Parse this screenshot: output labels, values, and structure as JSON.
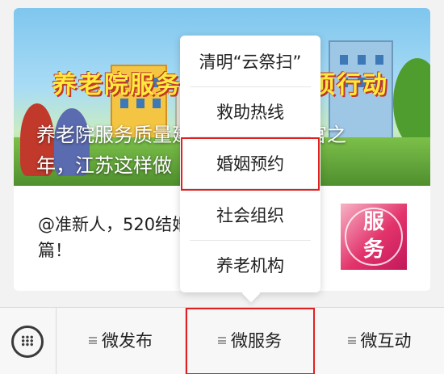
{
  "article": {
    "banner_text": "养老院服务质量建设专项行动",
    "headline_line1": "养老院服务质量建设专项行动收官之",
    "headline_line2": "年，江苏这样做",
    "summary_line1": "@准新人，520结婚登记攻略",
    "summary_line2": "篇！",
    "badge_line1": "服",
    "badge_line2": "务"
  },
  "menu": {
    "items": [
      {
        "label": "清明“云祭扫”"
      },
      {
        "label": "救助热线"
      },
      {
        "label": "婚姻预约"
      },
      {
        "label": "社会组织"
      },
      {
        "label": "养老机构"
      }
    ]
  },
  "tabbar": {
    "keyboard_icon": "keyboard-icon",
    "tabs": [
      {
        "label": "微发布"
      },
      {
        "label": "微服务"
      },
      {
        "label": "微互动"
      }
    ]
  },
  "colors": {
    "highlight": "#e02020",
    "badge": "#e2336b"
  }
}
